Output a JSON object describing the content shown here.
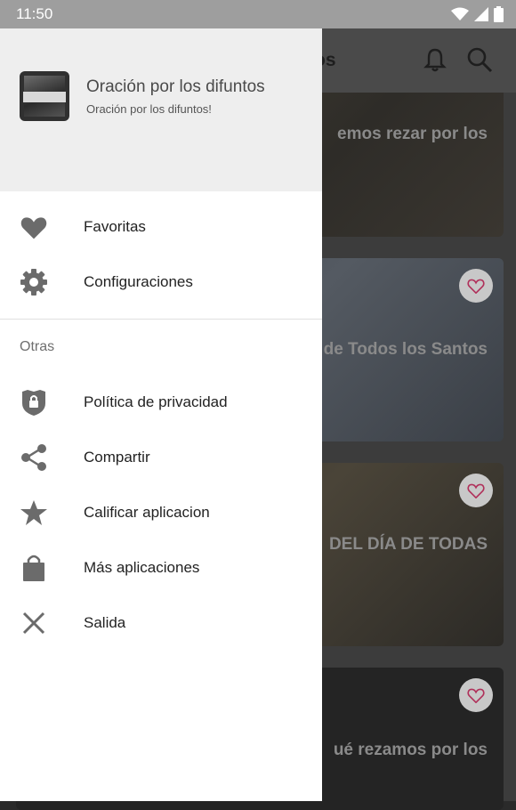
{
  "status_bar": {
    "time": "11:50"
  },
  "drawer": {
    "header": {
      "title": "Oración por los difuntos",
      "subtitle": "Oración por los difuntos!"
    },
    "primary_items": [
      {
        "label": "Favoritas",
        "icon": "heart-icon"
      },
      {
        "label": "Configuraciones",
        "icon": "gear-icon"
      }
    ],
    "section_title": "Otras",
    "secondary_items": [
      {
        "label": "Política de privacidad",
        "icon": "shield-lock-icon"
      },
      {
        "label": "Compartir",
        "icon": "share-icon"
      },
      {
        "label": "Calificar aplicacion",
        "icon": "star-icon"
      },
      {
        "label": "Más aplicaciones",
        "icon": "shopping-bag-icon"
      },
      {
        "label": "Salida",
        "icon": "close-icon"
      }
    ]
  },
  "background_app": {
    "title_fragment": "tos",
    "cards": [
      {
        "text": "emos rezar por los"
      },
      {
        "text": "de Todos los Santos"
      },
      {
        "text": "DEL DÍA DE TODAS"
      },
      {
        "text": "ué rezamos por los"
      }
    ]
  },
  "colors": {
    "drawer_bg": "#ffffff",
    "header_bg": "#eeeeee",
    "icon_gray": "#6b6b6b",
    "heart_accent": "#c2185b",
    "scrim": "#3c3c3c"
  }
}
